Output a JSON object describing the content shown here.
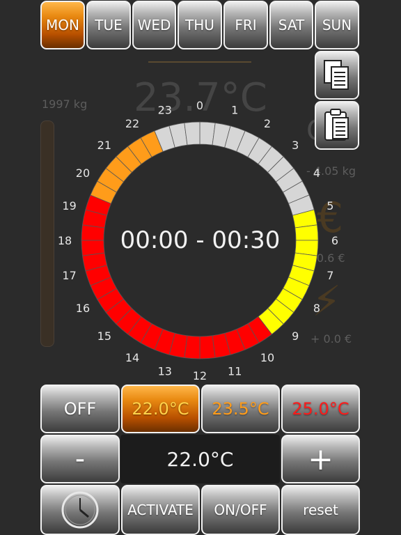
{
  "days": [
    "MON",
    "TUE",
    "WED",
    "THU",
    "FRI",
    "SAT",
    "SUN"
  ],
  "active_day": "MON",
  "background": {
    "temperature": "23.7°C",
    "weight": "1997 kg",
    "co2_value": "- 4.05 kg",
    "euro_value": "- 0.6 €",
    "energy_value": "+ 0.0 €"
  },
  "dial": {
    "time_range": "00:00 - 00:30",
    "hour_labels": [
      "0",
      "1",
      "2",
      "3",
      "4",
      "5",
      "6",
      "7",
      "8",
      "9",
      "10",
      "11",
      "12",
      "13",
      "14",
      "15",
      "16",
      "17",
      "18",
      "19",
      "20",
      "21",
      "22",
      "23"
    ],
    "legend": {
      "off": "#d6d6d6",
      "low": "#ff9c1a",
      "mid": "#ffff00",
      "high": "#ff0000"
    },
    "segment_levels": [
      "off",
      "off",
      "off",
      "off",
      "off",
      "off",
      "off",
      "off",
      "off",
      "off",
      "mid",
      "mid",
      "mid",
      "mid",
      "mid",
      "mid",
      "mid",
      "mid",
      "mid",
      "high",
      "high",
      "high",
      "high",
      "high",
      "high",
      "high",
      "high",
      "high",
      "high",
      "high",
      "high",
      "high",
      "high",
      "high",
      "high",
      "high",
      "high",
      "high",
      "high",
      "low",
      "low",
      "low",
      "low",
      "low",
      "low",
      "off",
      "off",
      "off"
    ]
  },
  "presets": {
    "off_label": "OFF",
    "low": {
      "label": "22.0°C",
      "color": "#ffd24a"
    },
    "mid": {
      "label": "23.5°C",
      "color": "#ff9c1a"
    },
    "high": {
      "label": "25.0°C",
      "color": "#ff1a1a"
    }
  },
  "controls": {
    "minus_label": "-",
    "current_temp": "22.0°C",
    "plus_label": "+",
    "activate_label": "ACTIVATE",
    "onoff_label": "ON/OFF",
    "reset_label": "reset"
  },
  "icons": {
    "copy": "copy-icon",
    "paste": "paste-icon",
    "clock": "clock-icon"
  }
}
